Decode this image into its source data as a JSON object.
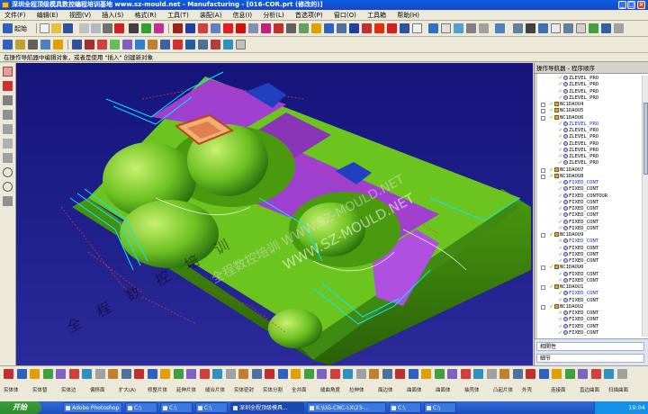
{
  "window": {
    "title": "深圳全程顶级模具数控编程培训基地 www.sz-mould.net - Manufacturing - [016-COR.prt (修改的)]",
    "min": "_",
    "max": "□",
    "close": "×"
  },
  "menubar": {
    "items": [
      "文件(F)",
      "编辑(E)",
      "视图(V)",
      "插入(S)",
      "格式(R)",
      "工具(T)",
      "装配(A)",
      "信息(I)",
      "分析(L)",
      "首选项(P)",
      "窗口(O)",
      "工具箱",
      "帮助(H)"
    ]
  },
  "toolbar1": {
    "start_label": "起始"
  },
  "cue_line": "在操作导航器中编辑对象，或者是使用 \"插入\" 创建新对象",
  "watermarks": {
    "line1": "WWW.SZ-MOULD.NET",
    "line2": "全程数控培训 WWW.SZ-MOULD.NET",
    "line3": "全 程 数 控 培 训"
  },
  "operation_navigator": {
    "title": "操作导航器 - 程序顺序",
    "rows": [
      {
        "label": "ZLEVEL_PRO",
        "kind": "op",
        "blue": false
      },
      {
        "label": "ZLEVEL_PRO",
        "kind": "op",
        "blue": false
      },
      {
        "label": "ZLEVEL_PRO",
        "kind": "op",
        "blue": false
      },
      {
        "label": "ZLEVEL_PRO",
        "kind": "op",
        "blue": false
      },
      {
        "label": "NC1DAOU4",
        "kind": "grp",
        "blue": false
      },
      {
        "label": "NC1DAOU5",
        "kind": "grp",
        "blue": false
      },
      {
        "label": "NC1DAOU6",
        "kind": "grp",
        "blue": false
      },
      {
        "label": "ZLEVEL_PRO",
        "kind": "op",
        "blue": true
      },
      {
        "label": "ZLEVEL_PRO",
        "kind": "op",
        "blue": false
      },
      {
        "label": "ZLEVEL_PRO",
        "kind": "op",
        "blue": false
      },
      {
        "label": "ZLEVEL_PRO",
        "kind": "op",
        "blue": false
      },
      {
        "label": "ZLEVEL_PRO",
        "kind": "op",
        "blue": false
      },
      {
        "label": "ZLEVEL_PRO",
        "kind": "op",
        "blue": false
      },
      {
        "label": "ZLEVEL_PRO",
        "kind": "op",
        "blue": false
      },
      {
        "label": "NC1DAOU7",
        "kind": "grp",
        "blue": false
      },
      {
        "label": "NC1DAOU8",
        "kind": "grp",
        "blue": false
      },
      {
        "label": "FIXED_CONT",
        "kind": "op",
        "blue": true
      },
      {
        "label": "FIXED_CONT",
        "kind": "op",
        "blue": false
      },
      {
        "label": "FIXED_CONTOUR",
        "kind": "op",
        "blue": false
      },
      {
        "label": "FIXED_CONT",
        "kind": "op",
        "blue": false
      },
      {
        "label": "FIXED_CONT",
        "kind": "op",
        "blue": false
      },
      {
        "label": "FIXED_CONT",
        "kind": "op",
        "blue": false
      },
      {
        "label": "FIXED_CONT",
        "kind": "op",
        "blue": false
      },
      {
        "label": "FIXED_CONT",
        "kind": "op",
        "blue": false
      },
      {
        "label": "NC1DAOU9",
        "kind": "grp",
        "blue": false
      },
      {
        "label": "FIXED_CONT",
        "kind": "op",
        "blue": true
      },
      {
        "label": "FIXED_CONT",
        "kind": "op",
        "blue": false
      },
      {
        "label": "FIXED_CONT",
        "kind": "op",
        "blue": false
      },
      {
        "label": "FIXED_CONT",
        "kind": "op",
        "blue": false
      },
      {
        "label": "NC1DAOU0",
        "kind": "grp",
        "blue": false
      },
      {
        "label": "FIXED_CONT",
        "kind": "op",
        "blue": false
      },
      {
        "label": "FIXED_CONT",
        "kind": "op",
        "blue": false
      },
      {
        "label": "NC1DAOU1",
        "kind": "grp",
        "blue": false
      },
      {
        "label": "FIXED_CONT",
        "kind": "op",
        "blue": true
      },
      {
        "label": "FIXED_CONT",
        "kind": "op",
        "blue": false
      },
      {
        "label": "NC1DAOU2",
        "kind": "grp",
        "blue": false
      },
      {
        "label": "FIXED_CONT",
        "kind": "op",
        "blue": false
      },
      {
        "label": "FIXED_CONT",
        "kind": "op",
        "blue": false
      },
      {
        "label": "FIXED_CONT",
        "kind": "op",
        "blue": false
      },
      {
        "label": "FIXED_CONT",
        "kind": "op",
        "blue": false
      }
    ],
    "bottom_tabs": [
      "相関性",
      "細节"
    ]
  },
  "bottom_toolbar": {
    "labels": [
      "实体体",
      "实体替",
      "实体边",
      "偏移面",
      "扩大(A)",
      "修整片体",
      "延伸片体",
      "缝合片体",
      "实体密封",
      "实体分割",
      "全并面",
      "缝曲角度",
      "拉伸体",
      "面边体",
      "曲面体",
      "曲面体",
      "抽壳体",
      "凸起片体",
      "外壳",
      "连接面",
      "直边曲面",
      "扫描曲面"
    ]
  },
  "taskbar": {
    "start": "开始",
    "tasks": [
      "Adobe Photoshop ...",
      "C:\\",
      "C:\\",
      "C:\\",
      "深圳全程顶级模具...",
      "K:\\UG-CNC-LX\\23-...",
      "C:\\",
      "C:\\"
    ],
    "clock": "19:04"
  }
}
